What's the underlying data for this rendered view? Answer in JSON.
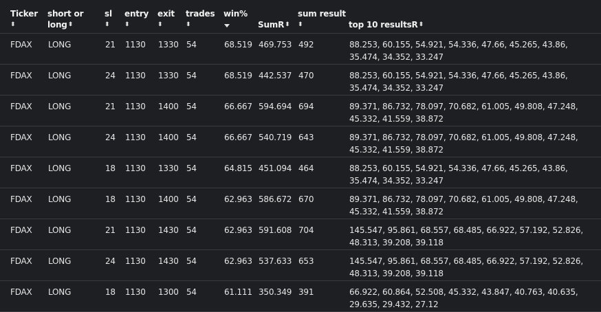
{
  "columns": [
    {
      "line1": "Ticker",
      "line2": "",
      "sort": "both"
    },
    {
      "line1": "short or",
      "line2": "long",
      "sort": "both"
    },
    {
      "line1": "sl",
      "line2": "",
      "sort": "both"
    },
    {
      "line1": "entry",
      "line2": "",
      "sort": "both"
    },
    {
      "line1": "exit",
      "line2": "",
      "sort": "both"
    },
    {
      "line1": "trades",
      "line2": "",
      "sort": "both"
    },
    {
      "line1": "win%",
      "line2": "",
      "sort": "desc"
    },
    {
      "line1": "",
      "line2": "SumR",
      "sort": "both"
    },
    {
      "line1": "sum result",
      "line2": "",
      "sort": "both"
    },
    {
      "line1": "",
      "line2": "top 10 resultsR",
      "sort": "both"
    }
  ],
  "sort_icons": {
    "both": "⬍",
    "desc": "desc-arrow"
  },
  "rows": [
    [
      "FDAX",
      "LONG",
      "21",
      "1130",
      "1330",
      "54",
      "68.519",
      "469.753",
      "492",
      "88.253, 60.155, 54.921, 54.336, 47.66, 45.265, 43.86, 35.474, 34.352, 33.247"
    ],
    [
      "FDAX",
      "LONG",
      "24",
      "1130",
      "1330",
      "54",
      "68.519",
      "442.537",
      "470",
      "88.253, 60.155, 54.921, 54.336, 47.66, 45.265, 43.86, 35.474, 34.352, 33.247"
    ],
    [
      "FDAX",
      "LONG",
      "21",
      "1130",
      "1400",
      "54",
      "66.667",
      "594.694",
      "694",
      "89.371, 86.732, 78.097, 70.682, 61.005, 49.808, 47.248, 45.332, 41.559, 38.872"
    ],
    [
      "FDAX",
      "LONG",
      "24",
      "1130",
      "1400",
      "54",
      "66.667",
      "540.719",
      "643",
      "89.371, 86.732, 78.097, 70.682, 61.005, 49.808, 47.248, 45.332, 41.559, 38.872"
    ],
    [
      "FDAX",
      "LONG",
      "18",
      "1130",
      "1330",
      "54",
      "64.815",
      "451.094",
      "464",
      "88.253, 60.155, 54.921, 54.336, 47.66, 45.265, 43.86, 35.474, 34.352, 33.247"
    ],
    [
      "FDAX",
      "LONG",
      "18",
      "1130",
      "1400",
      "54",
      "62.963",
      "586.672",
      "670",
      "89.371, 86.732, 78.097, 70.682, 61.005, 49.808, 47.248, 45.332, 41.559, 38.872"
    ],
    [
      "FDAX",
      "LONG",
      "21",
      "1130",
      "1430",
      "54",
      "62.963",
      "591.608",
      "704",
      "145.547, 95.861, 68.557, 68.485, 66.922, 57.192, 52.826, 48.313, 39.208, 39.118"
    ],
    [
      "FDAX",
      "LONG",
      "24",
      "1130",
      "1430",
      "54",
      "62.963",
      "537.633",
      "653",
      "145.547, 95.861, 68.557, 68.485, 66.922, 57.192, 52.826, 48.313, 39.208, 39.118"
    ],
    [
      "FDAX",
      "LONG",
      "18",
      "1130",
      "1300",
      "54",
      "61.111",
      "350.349",
      "391",
      "66.922, 60.864, 52.508, 45.332, 43.847, 40.763, 40.635, 29.635, 29.432, 27.12"
    ]
  ]
}
